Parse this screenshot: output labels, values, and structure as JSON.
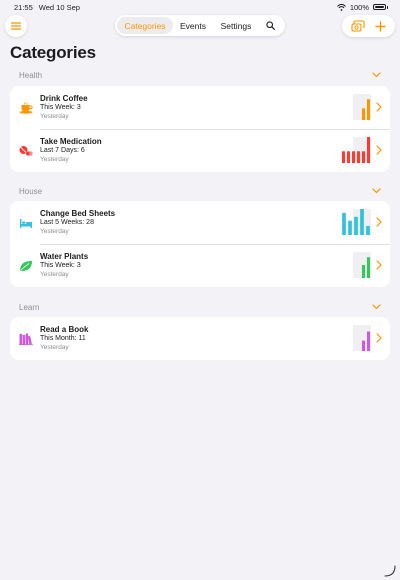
{
  "status": {
    "time": "21:55",
    "date": "Wed 10 Sep",
    "battery": "100%"
  },
  "nav": {
    "tabs": [
      {
        "label": "Categories",
        "active": true
      },
      {
        "label": "Events",
        "active": false
      },
      {
        "label": "Settings",
        "active": false
      }
    ]
  },
  "page_title": "Categories",
  "accent_color": "#ff9500",
  "sections": [
    {
      "title": "Health",
      "items": [
        {
          "title": "Drink Coffee",
          "summary": "This Week: 3",
          "last": "Yesterday",
          "icon": "coffee-cup-icon",
          "color": "#ff9500",
          "bars": [
            0,
            0,
            0,
            0,
            0.45,
            0.8
          ]
        },
        {
          "title": "Take Medication",
          "summary": "Last 7 Days: 6",
          "last": "Yesterday",
          "icon": "pills-icon",
          "color": "#ff3b30",
          "bars": [
            0.45,
            0.45,
            0.45,
            0.45,
            0.45,
            1.0
          ]
        }
      ]
    },
    {
      "title": "House",
      "items": [
        {
          "title": "Change Bed Sheets",
          "summary": "Last 5 Weeks: 28",
          "last": "Yesterday",
          "icon": "bed-icon",
          "color": "#32c2de",
          "bars": [
            0.85,
            0.55,
            0.7,
            1.0,
            0.35
          ]
        },
        {
          "title": "Water Plants",
          "summary": "This Week: 3",
          "last": "Yesterday",
          "icon": "leaf-icon",
          "color": "#34c759",
          "bars": [
            0,
            0,
            0,
            0,
            0.5,
            0.8
          ]
        }
      ]
    },
    {
      "title": "Learn",
      "items": [
        {
          "title": "Read a Book",
          "summary": "This Month: 11",
          "last": "Yesterday",
          "icon": "books-icon",
          "color": "#cc5ae0",
          "bars": [
            0,
            0,
            0,
            0,
            0.4,
            0.75
          ]
        }
      ]
    }
  ]
}
